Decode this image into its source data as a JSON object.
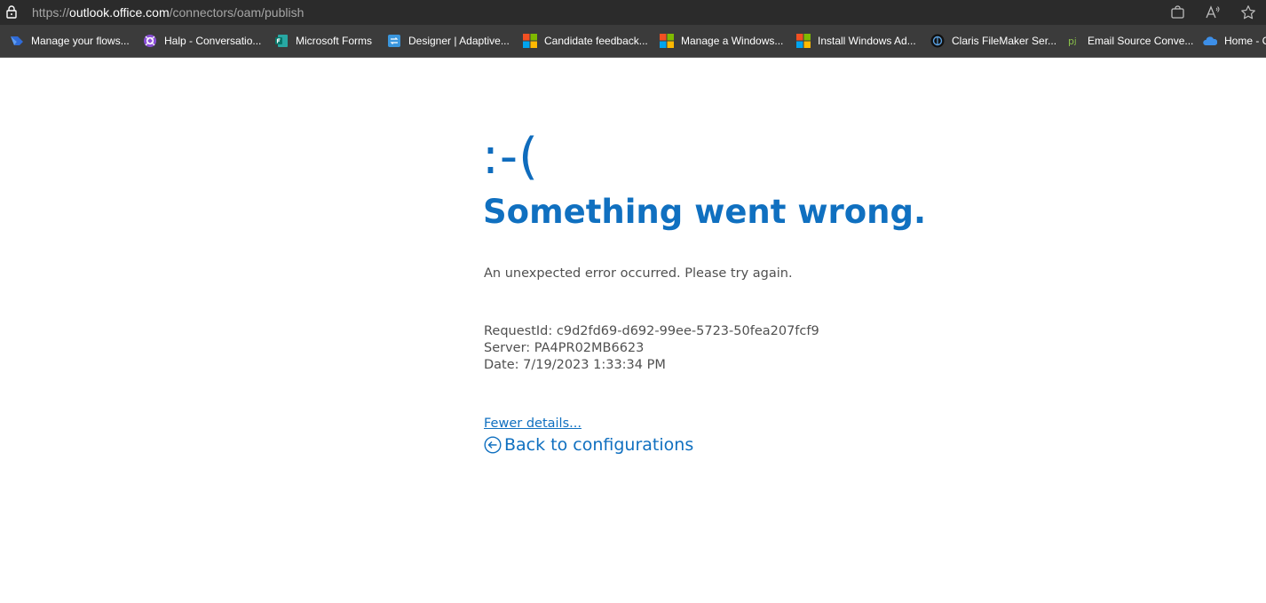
{
  "browser": {
    "url": {
      "scheme": "https://",
      "host": "outlook.office.com",
      "path": "/connectors/oam/publish"
    },
    "bookmarks": [
      {
        "label": "Manage your flows...",
        "icon": "power-automate-icon"
      },
      {
        "label": "Halp - Conversatio...",
        "icon": "halp-icon"
      },
      {
        "label": "Microsoft Forms",
        "icon": "forms-icon"
      },
      {
        "label": "Designer | Adaptive...",
        "icon": "adaptive-cards-icon"
      },
      {
        "label": "Candidate feedback...",
        "icon": "microsoft-logo-icon"
      },
      {
        "label": "Manage a Windows...",
        "icon": "microsoft-logo-icon"
      },
      {
        "label": "Install Windows Ad...",
        "icon": "microsoft-logo-icon"
      },
      {
        "label": "Claris FileMaker Ser...",
        "icon": "claris-icon"
      },
      {
        "label": "Email Source Conve...",
        "icon": "pj-icon"
      },
      {
        "label": "Home - C",
        "icon": "onedrive-icon"
      }
    ]
  },
  "error_page": {
    "face": ":-(",
    "title": "Something went wrong.",
    "message": "An unexpected error occurred. Please try again.",
    "request_id": "RequestId: c9d2fd69-d692-99ee-5723-50fea207fcf9",
    "server": "Server: PA4PR02MB6623",
    "date": "Date: 7/19/2023 1:33:34 PM",
    "fewer_details": "Fewer details...",
    "back_link": "Back to configurations"
  },
  "colors": {
    "accent": "#0f6cbd",
    "text_secondary": "#505050"
  }
}
